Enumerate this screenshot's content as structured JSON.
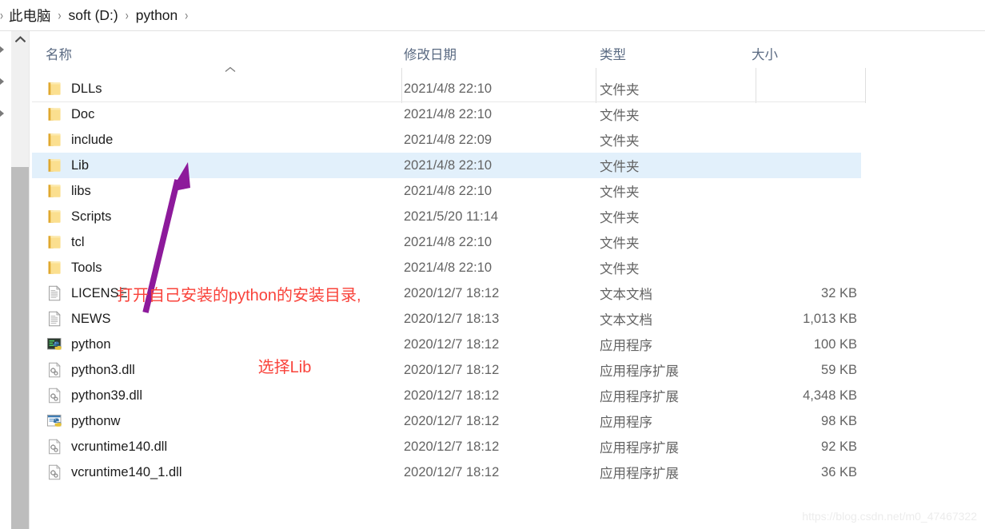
{
  "breadcrumb": {
    "leading_separator": "›",
    "separator": "›",
    "items": [
      "此电脑",
      "soft (D:)",
      "python"
    ]
  },
  "columns": {
    "name": "名称",
    "date_modified": "修改日期",
    "type": "类型",
    "size": "大小",
    "sort_indicator": "ascending-caret",
    "sorted_by": "名称"
  },
  "selection": {
    "selected_name": "Lib",
    "highlight_color": "#e2f0fb"
  },
  "scrollbar": {
    "up_arrow_icon": "chevron-up-icon",
    "thumb_color": "#bdbdbd",
    "track_color": "#f0f0f0"
  },
  "nav_pane_chevrons": [
    "chevron-right-icon",
    "chevron-right-icon",
    "chevron-right-icon"
  ],
  "rows": [
    {
      "icon": "folder-icon",
      "name": "DLLs",
      "date": "2021/4/8 22:10",
      "type": "文件夹",
      "size": "",
      "selected": false
    },
    {
      "icon": "folder-icon",
      "name": "Doc",
      "date": "2021/4/8 22:10",
      "type": "文件夹",
      "size": "",
      "selected": false
    },
    {
      "icon": "folder-icon",
      "name": "include",
      "date": "2021/4/8 22:09",
      "type": "文件夹",
      "size": "",
      "selected": false
    },
    {
      "icon": "folder-icon",
      "name": "Lib",
      "date": "2021/4/8 22:10",
      "type": "文件夹",
      "size": "",
      "selected": true
    },
    {
      "icon": "folder-icon",
      "name": "libs",
      "date": "2021/4/8 22:10",
      "type": "文件夹",
      "size": "",
      "selected": false
    },
    {
      "icon": "folder-icon",
      "name": "Scripts",
      "date": "2021/5/20 11:14",
      "type": "文件夹",
      "size": "",
      "selected": false
    },
    {
      "icon": "folder-icon",
      "name": "tcl",
      "date": "2021/4/8 22:10",
      "type": "文件夹",
      "size": "",
      "selected": false
    },
    {
      "icon": "folder-icon",
      "name": "Tools",
      "date": "2021/4/8 22:10",
      "type": "文件夹",
      "size": "",
      "selected": false
    },
    {
      "icon": "text-document-icon",
      "name": "LICENSE",
      "date": "2020/12/7 18:12",
      "type": "文本文档",
      "size": "32 KB",
      "selected": false
    },
    {
      "icon": "text-document-icon",
      "name": "NEWS",
      "date": "2020/12/7 18:13",
      "type": "文本文档",
      "size": "1,013 KB",
      "selected": false
    },
    {
      "icon": "python-console-app-icon",
      "name": "python",
      "date": "2020/12/7 18:12",
      "type": "应用程序",
      "size": "100 KB",
      "selected": false
    },
    {
      "icon": "dll-icon",
      "name": "python3.dll",
      "date": "2020/12/7 18:12",
      "type": "应用程序扩展",
      "size": "59 KB",
      "selected": false
    },
    {
      "icon": "dll-icon",
      "name": "python39.dll",
      "date": "2020/12/7 18:12",
      "type": "应用程序扩展",
      "size": "4,348 KB",
      "selected": false
    },
    {
      "icon": "pythonw-app-icon",
      "name": "pythonw",
      "date": "2020/12/7 18:12",
      "type": "应用程序",
      "size": "98 KB",
      "selected": false
    },
    {
      "icon": "dll-icon",
      "name": "vcruntime140.dll",
      "date": "2020/12/7 18:12",
      "type": "应用程序扩展",
      "size": "92 KB",
      "selected": false
    },
    {
      "icon": "dll-icon",
      "name": "vcruntime140_1.dll",
      "date": "2020/12/7 18:12",
      "type": "应用程序扩展",
      "size": "36 KB",
      "selected": false
    }
  ],
  "annotation": {
    "line_1": "打开自己安装的python的安装目录,",
    "line_2": "选择Lib",
    "text_color": "#f9423a",
    "arrow_color": "#8d1a9b",
    "arrow_points_to": "Lib"
  },
  "watermark": {
    "text": "https://blog.csdn.net/m0_47467322"
  }
}
